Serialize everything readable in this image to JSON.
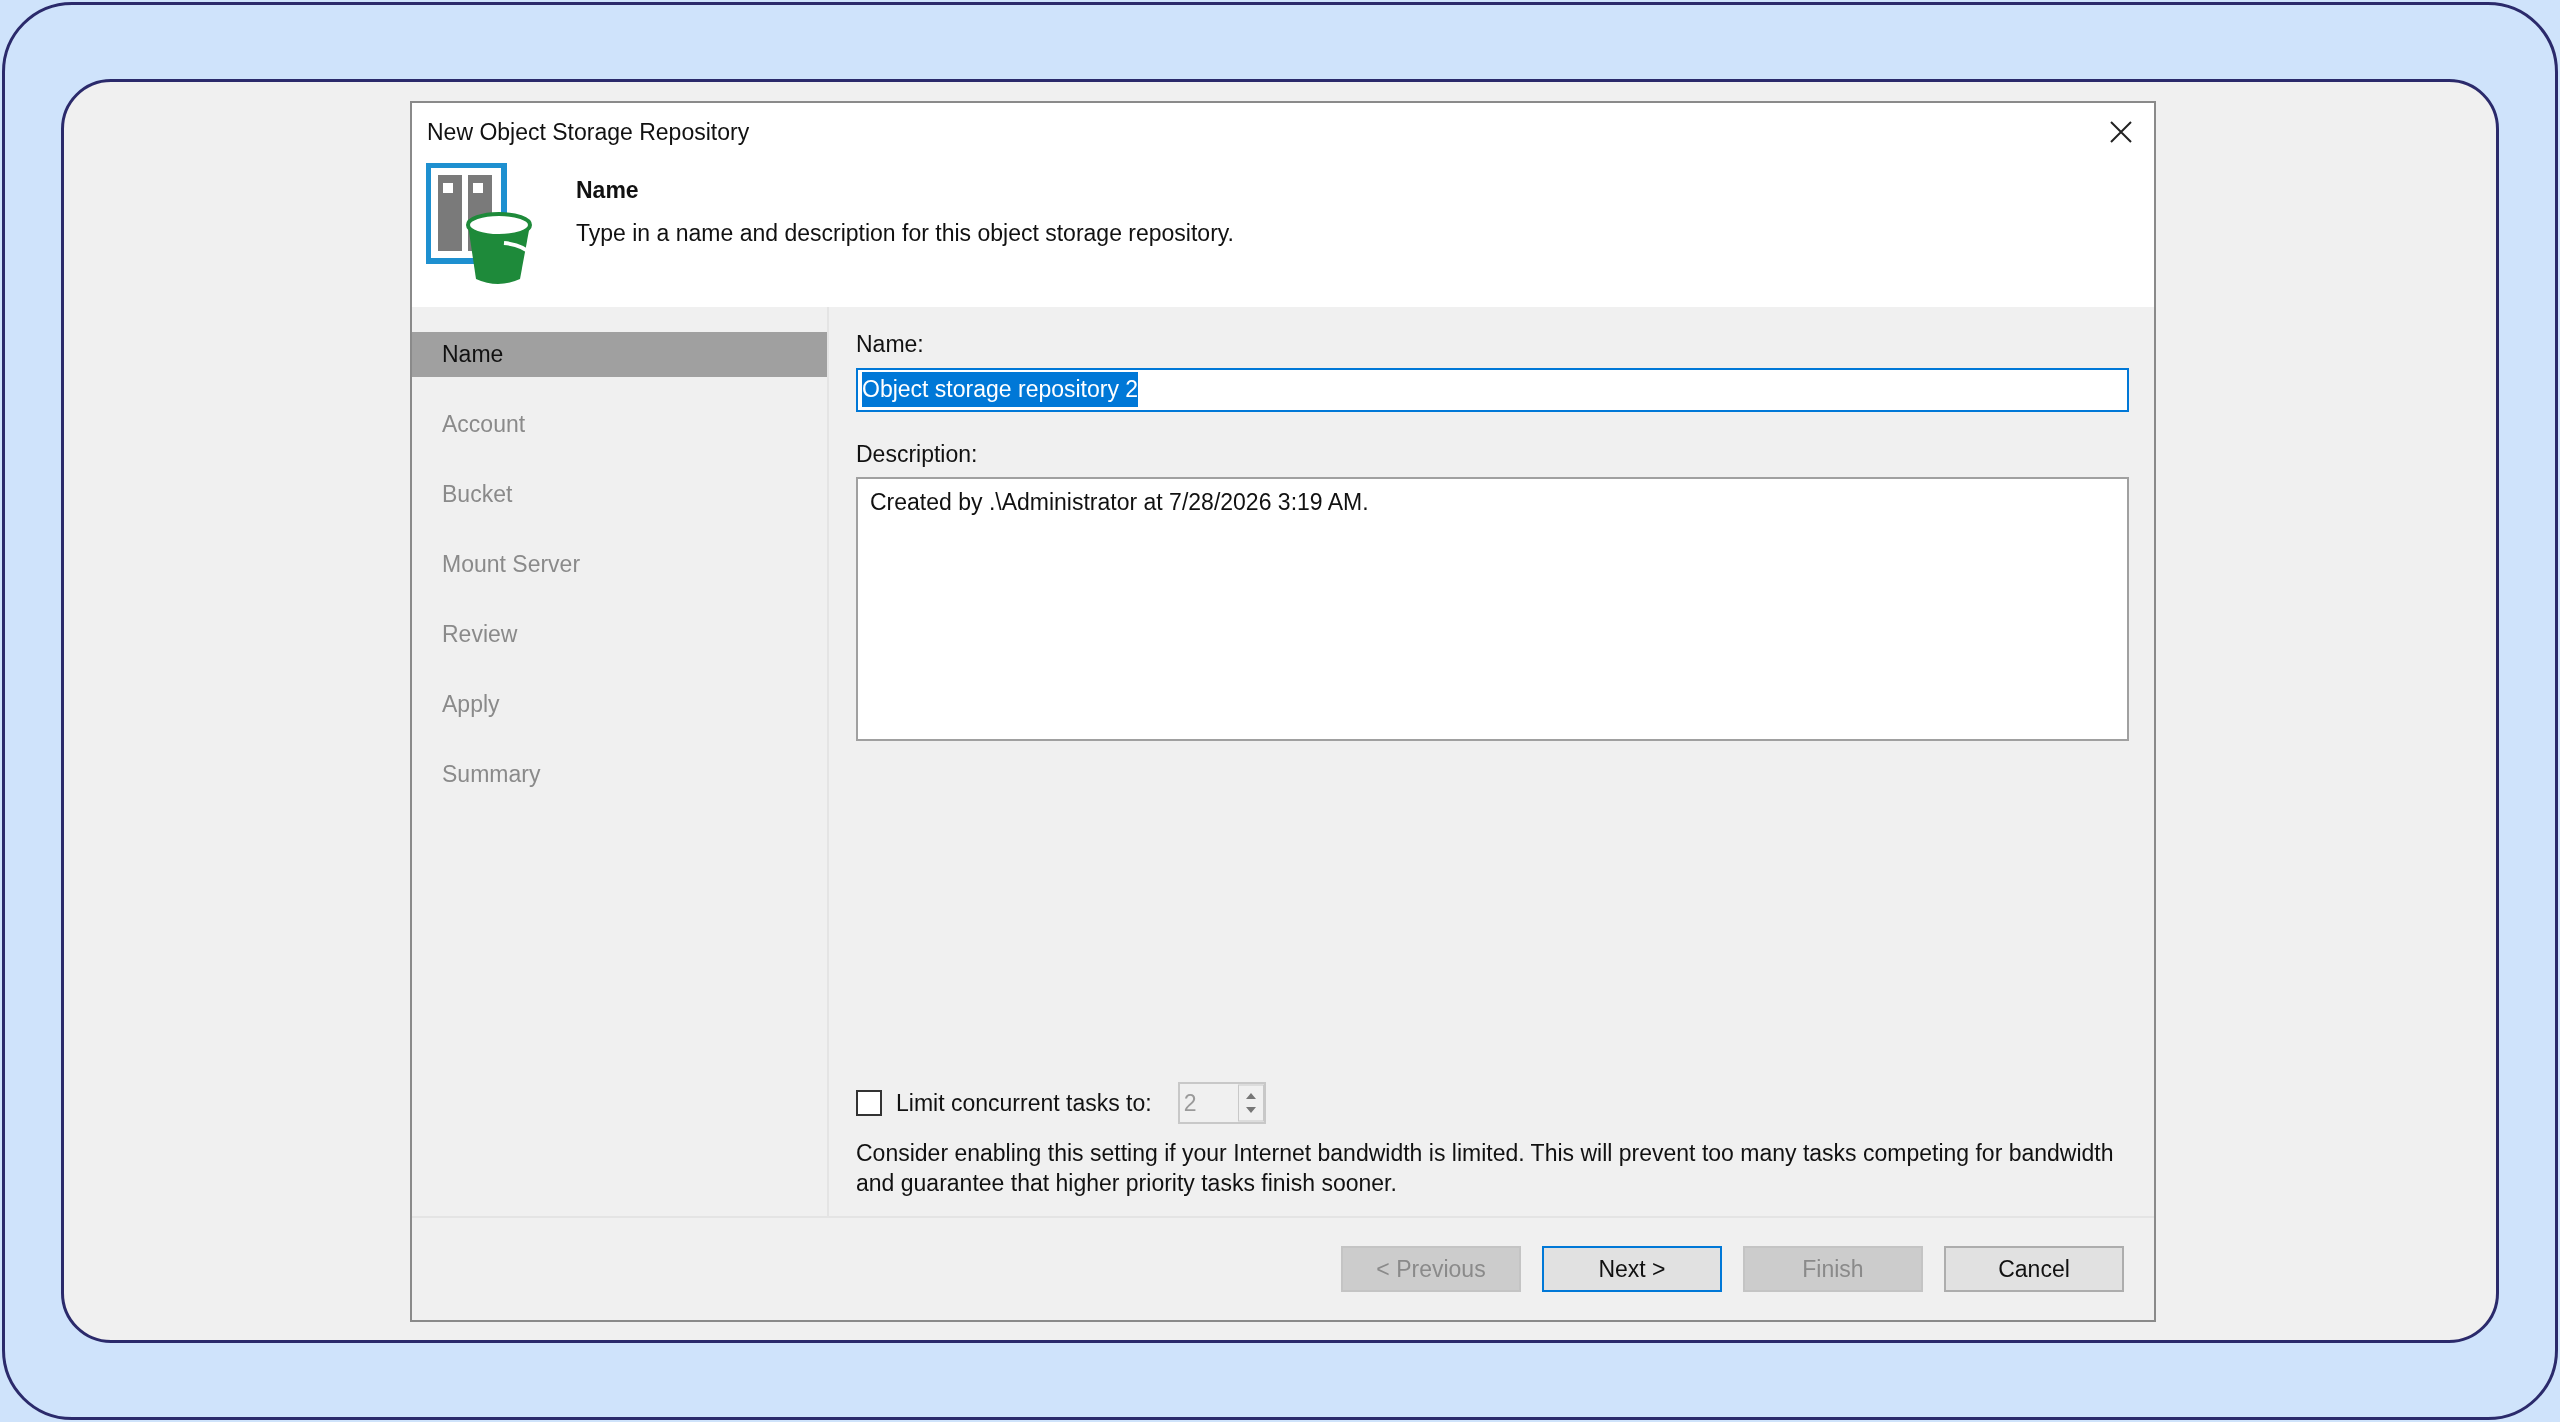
{
  "window": {
    "title": "New Object Storage Repository"
  },
  "header": {
    "title": "Name",
    "subtitle": "Type in a name and description for this object storage repository."
  },
  "steps": [
    {
      "label": "Name",
      "selected": true
    },
    {
      "label": "Account",
      "selected": false
    },
    {
      "label": "Bucket",
      "selected": false
    },
    {
      "label": "Mount Server",
      "selected": false
    },
    {
      "label": "Review",
      "selected": false
    },
    {
      "label": "Apply",
      "selected": false
    },
    {
      "label": "Summary",
      "selected": false
    }
  ],
  "name_field": {
    "label": "Name:",
    "value": "Object storage repository 2",
    "selected": true
  },
  "description_field": {
    "label": "Description:",
    "value": "Created by .\\Administrator at 7/28/2026 3:19 AM."
  },
  "limit_tasks": {
    "label": "Limit concurrent tasks to:",
    "checked": false,
    "value": "2",
    "disabled": true
  },
  "hint": "Consider enabling this setting if your Internet bandwidth is limited. This will prevent too many tasks competing for bandwidth and guarantee that higher priority tasks finish sooner.",
  "buttons": [
    {
      "label": "< Previous",
      "disabled": true,
      "default": false
    },
    {
      "label": "Next >",
      "disabled": false,
      "default": true
    },
    {
      "label": "Finish",
      "disabled": true,
      "default": false
    },
    {
      "label": "Cancel",
      "disabled": false,
      "default": false
    }
  ]
}
